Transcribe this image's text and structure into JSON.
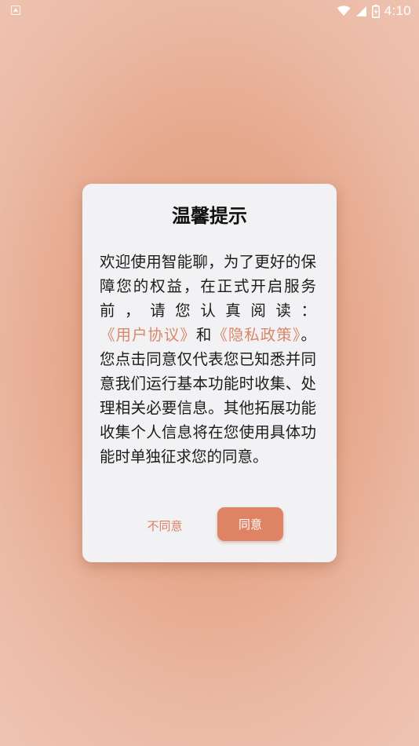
{
  "status_bar": {
    "time": "4:10",
    "left_icon": "a-notification-icon",
    "icons": [
      "wifi-icon",
      "cellular-signal-icon",
      "battery-icon"
    ]
  },
  "dialog": {
    "title": "温馨提示",
    "body": {
      "text_before_user": "欢迎使用智能聊，为了更好的保障您的权益，在正式开启服务前，请您认真阅读：",
      "user_agreement_link": "《用户协议》",
      "text_and": "和",
      "privacy_policy_link": "《隐私政策》",
      "text_after": "。您点击同意仅代表您已知悉并同意我们运行基本功能时收集、处理相关必要信息。其他拓展功能收集个人信息将在您使用具体功能时单独征求您的同意。"
    },
    "disagree_label": "不同意",
    "agree_label": "同意"
  },
  "colors": {
    "accent": "#de8364",
    "link": "#d9876a",
    "dialog_background": "#f2f2f4"
  }
}
